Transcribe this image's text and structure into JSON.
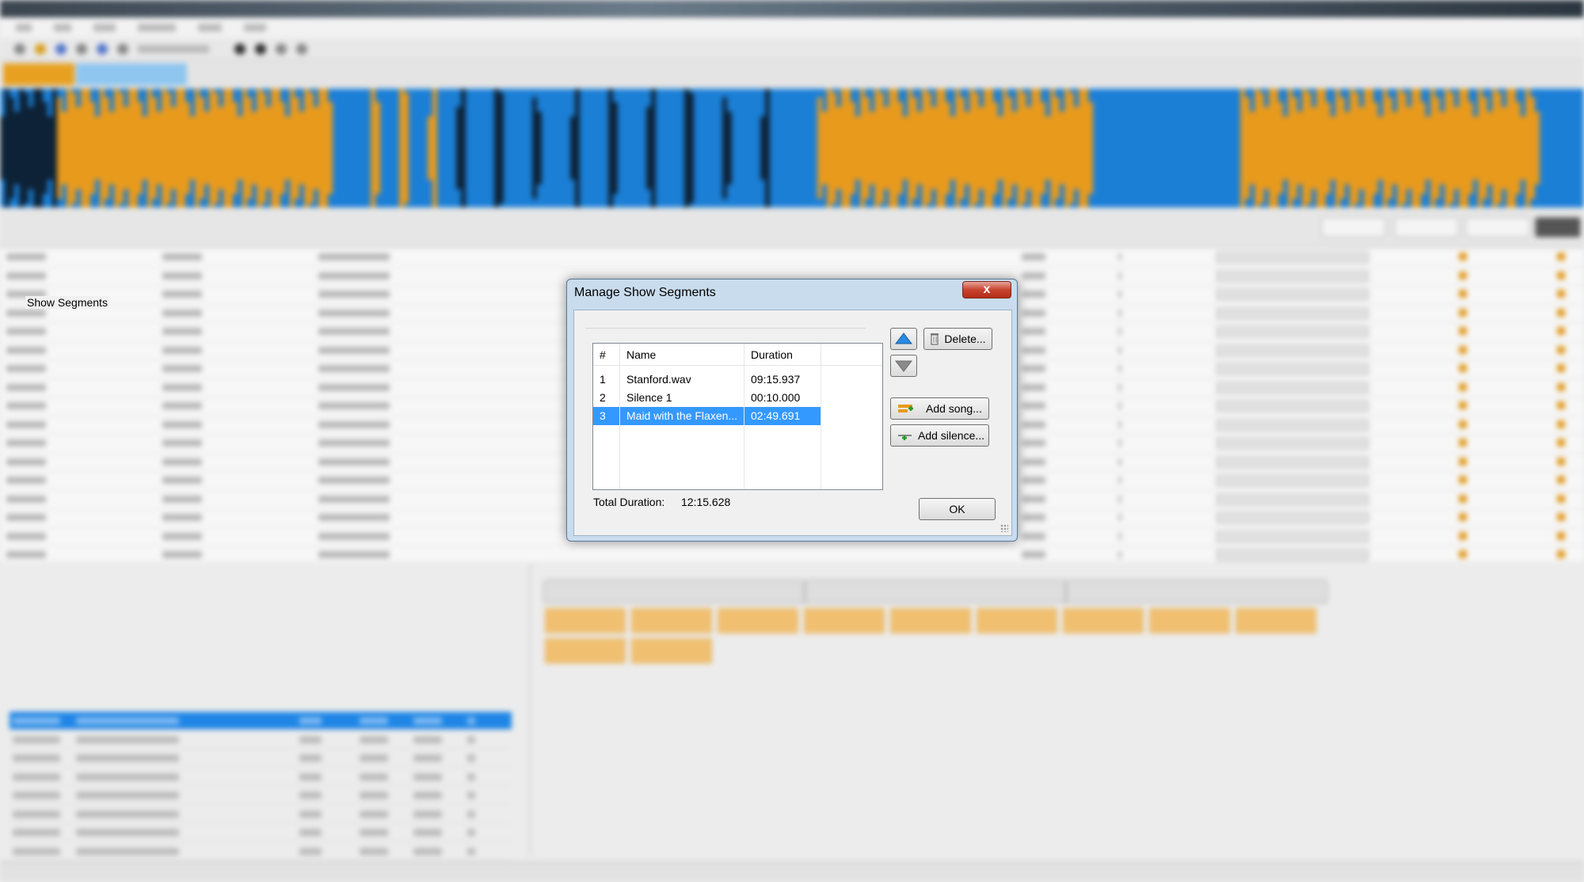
{
  "dialog": {
    "title": "Manage Show Segments",
    "close_label": "x",
    "group_label": "Show Segments",
    "columns": [
      "#",
      "Name",
      "Duration"
    ],
    "rows": [
      {
        "num": "1",
        "name": "Stanford.wav",
        "duration": "09:15.937"
      },
      {
        "num": "2",
        "name": "Silence 1",
        "duration": "00:10.000"
      },
      {
        "num": "3",
        "name": "Maid with the Flaxen...",
        "duration": "02:49.691",
        "selected": true
      }
    ],
    "buttons": {
      "move_up": "",
      "move_down": "",
      "delete": "Delete...",
      "add_song": "Add song...",
      "add_silence": "Add silence...",
      "ok": "OK"
    },
    "total_label": "Total Duration:",
    "total_value": "12:15.628"
  },
  "icons": {
    "up": "up-arrow-icon",
    "down": "down-arrow-icon",
    "delete": "trash-icon",
    "add_song": "add-song-icon",
    "add_silence": "add-silence-icon"
  },
  "colors": {
    "accent": "#3399ff",
    "wave_blue": "#1b7fd6",
    "wave_orange": "#e89a1c",
    "close_red": "#c8432f"
  }
}
